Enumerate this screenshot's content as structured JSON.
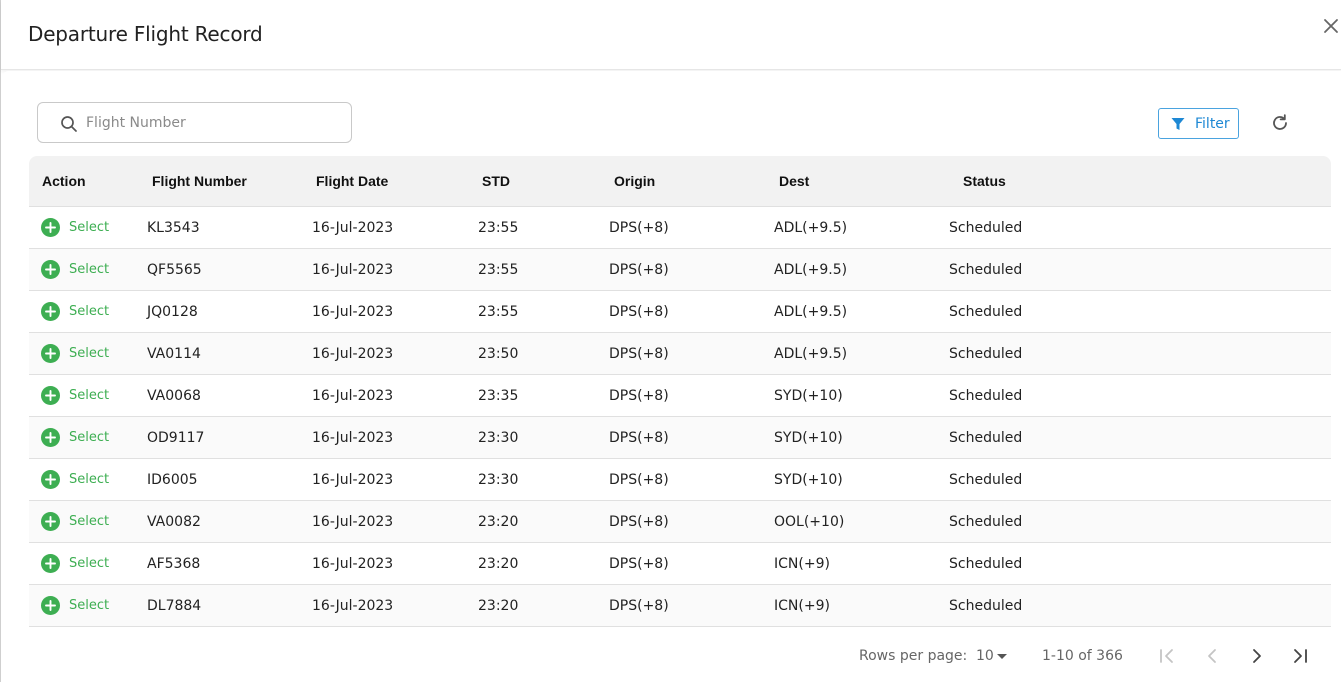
{
  "dialog": {
    "title": "Departure Flight Record",
    "close_icon": "close-icon"
  },
  "toolbar": {
    "search_placeholder": "Flight Number",
    "search_value": "",
    "filter_label": "Filter",
    "refresh_icon": "refresh-icon"
  },
  "colors": {
    "accent_blue": "#1e88d4",
    "select_green": "#3dae52",
    "header_bg": "#f2f2f2"
  },
  "table": {
    "headers": [
      "Action",
      "Flight Number",
      "Flight Date",
      "STD",
      "Origin",
      "Dest",
      "Status"
    ],
    "action_label": "Select",
    "rows": [
      {
        "flight": "KL3543",
        "date": "16-Jul-2023",
        "std": "23:55",
        "origin": "DPS(+8)",
        "dest": "ADL(+9.5)",
        "status": "Scheduled"
      },
      {
        "flight": "QF5565",
        "date": "16-Jul-2023",
        "std": "23:55",
        "origin": "DPS(+8)",
        "dest": "ADL(+9.5)",
        "status": "Scheduled"
      },
      {
        "flight": "JQ0128",
        "date": "16-Jul-2023",
        "std": "23:55",
        "origin": "DPS(+8)",
        "dest": "ADL(+9.5)",
        "status": "Scheduled"
      },
      {
        "flight": "VA0114",
        "date": "16-Jul-2023",
        "std": "23:50",
        "origin": "DPS(+8)",
        "dest": "ADL(+9.5)",
        "status": "Scheduled"
      },
      {
        "flight": "VA0068",
        "date": "16-Jul-2023",
        "std": "23:35",
        "origin": "DPS(+8)",
        "dest": "SYD(+10)",
        "status": "Scheduled"
      },
      {
        "flight": "OD9117",
        "date": "16-Jul-2023",
        "std": "23:30",
        "origin": "DPS(+8)",
        "dest": "SYD(+10)",
        "status": "Scheduled"
      },
      {
        "flight": "ID6005",
        "date": "16-Jul-2023",
        "std": "23:30",
        "origin": "DPS(+8)",
        "dest": "SYD(+10)",
        "status": "Scheduled"
      },
      {
        "flight": "VA0082",
        "date": "16-Jul-2023",
        "std": "23:20",
        "origin": "DPS(+8)",
        "dest": "OOL(+10)",
        "status": "Scheduled"
      },
      {
        "flight": "AF5368",
        "date": "16-Jul-2023",
        "std": "23:20",
        "origin": "DPS(+8)",
        "dest": "ICN(+9)",
        "status": "Scheduled"
      },
      {
        "flight": "DL7884",
        "date": "16-Jul-2023",
        "std": "23:20",
        "origin": "DPS(+8)",
        "dest": "ICN(+9)",
        "status": "Scheduled"
      }
    ]
  },
  "pagination": {
    "rows_per_page_label": "Rows per page:",
    "rows_per_page_value": "10",
    "range_text": "1-10 of 366",
    "first_icon": "first-page-icon",
    "prev_icon": "chevron-left-icon",
    "next_icon": "chevron-right-icon",
    "last_icon": "last-page-icon"
  }
}
